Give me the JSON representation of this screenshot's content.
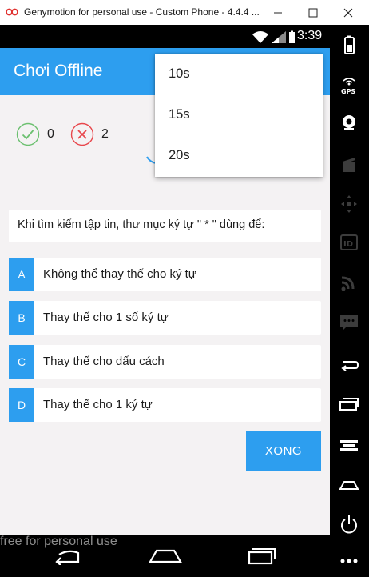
{
  "window": {
    "title": "Genymotion for personal use - Custom Phone - 4.4.4 ..."
  },
  "status_bar": {
    "time": "3:39"
  },
  "app": {
    "title": "Chơi Offline",
    "score": {
      "correct": "0",
      "wrong": "2"
    },
    "question": "Khi tìm kiếm tập tin, thư mục ký tự \" * \" dùng để:",
    "answers": [
      {
        "letter": "A",
        "text": "Không thể thay thế cho ký tự"
      },
      {
        "letter": "B",
        "text": "Thay thế cho 1 số ký tự"
      },
      {
        "letter": "C",
        "text": "Thay thế cho dấu cách"
      },
      {
        "letter": "D",
        "text": "Thay thế cho 1 ký tự"
      }
    ],
    "done_label": "XONG",
    "time_dropdown": {
      "options": [
        "10s",
        "15s",
        "20s"
      ]
    }
  },
  "watermark": "free for personal use",
  "colors": {
    "accent": "#2d9eef",
    "correct": "#6cc070",
    "wrong": "#e8474c",
    "background": "#f4f2f3"
  },
  "sidebar_icons": [
    "battery-icon",
    "gps-icon",
    "webcam-icon",
    "clapper-icon",
    "dpad-icon",
    "id-icon",
    "rss-icon",
    "message-icon",
    "back-icon",
    "recent-apps-icon",
    "menu-icon",
    "home-icon",
    "power-icon",
    "more-icon"
  ]
}
